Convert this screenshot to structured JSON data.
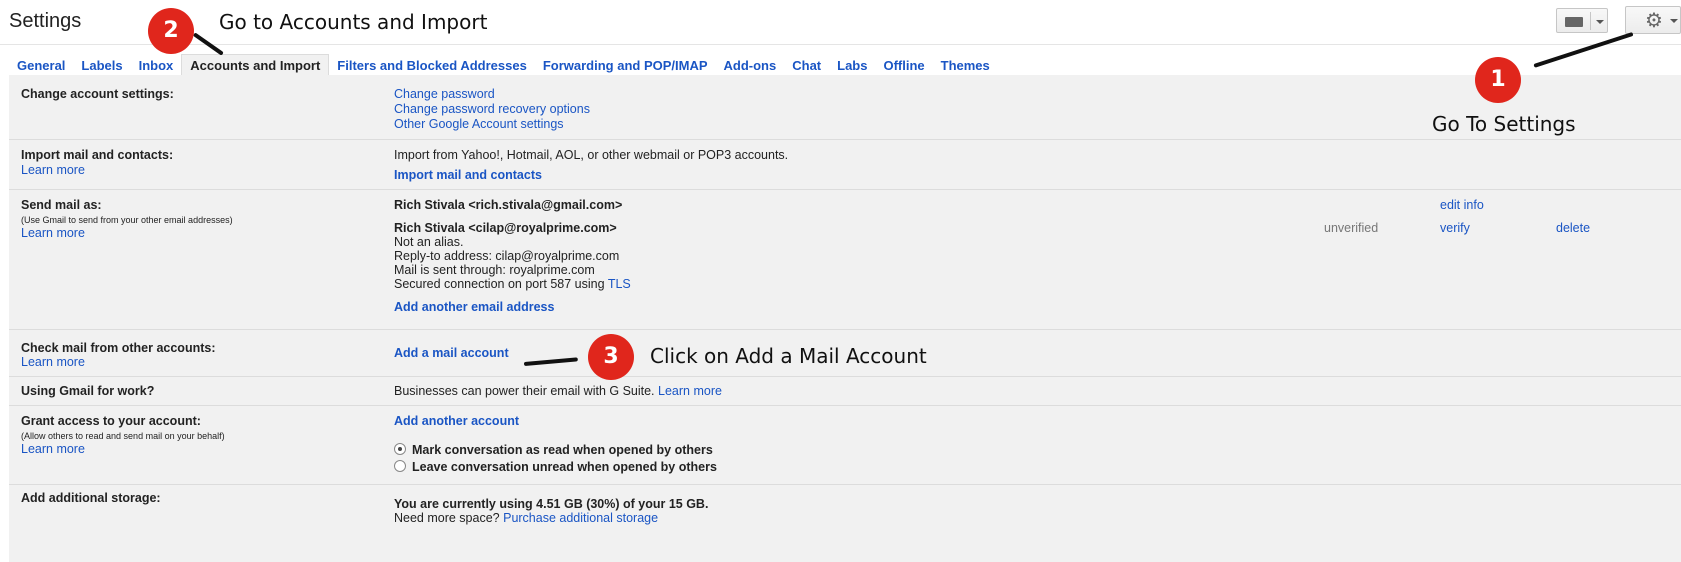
{
  "header": {
    "title": "Settings",
    "keyboard_icon": "keyboard-icon",
    "settings_icon": "gear-icon"
  },
  "tabs": [
    {
      "label": "General"
    },
    {
      "label": "Labels"
    },
    {
      "label": "Inbox"
    },
    {
      "label": "Accounts and Import",
      "active": true
    },
    {
      "label": "Filters and Blocked Addresses"
    },
    {
      "label": "Forwarding and POP/IMAP"
    },
    {
      "label": "Add-ons"
    },
    {
      "label": "Chat"
    },
    {
      "label": "Labs"
    },
    {
      "label": "Offline"
    },
    {
      "label": "Themes"
    }
  ],
  "sections": {
    "change_account": {
      "label": "Change account settings:",
      "links": [
        "Change password",
        "Change password recovery options",
        "Other Google Account settings"
      ]
    },
    "import": {
      "label": "Import mail and contacts:",
      "learn_more": "Learn more",
      "text": "Import from Yahoo!, Hotmail, AOL, or other webmail or POP3 accounts.",
      "action": "Import mail and contacts"
    },
    "send_as": {
      "label": "Send mail as:",
      "note": "(Use Gmail to send from your other email addresses)",
      "learn_more": "Learn more",
      "account1": "Rich Stivala <rich.stivala@gmail.com>",
      "edit_info": "edit info",
      "account2": "Rich Stivala <cilap@royalprime.com>",
      "status": "unverified",
      "verify": "verify",
      "delete": "delete",
      "alias": "Not an alias.",
      "reply_to": "Reply-to address: cilap@royalprime.com",
      "sent_through": "Mail is sent through: royalprime.com",
      "secured": "Secured connection on port 587 using",
      "tls": "TLS",
      "add_address": "Add another email address"
    },
    "check_mail": {
      "label": "Check mail from other accounts:",
      "learn_more": "Learn more",
      "action": "Add a mail account"
    },
    "work": {
      "label": "Using Gmail for work?",
      "text": "Businesses can power their email with G Suite.",
      "learn_more": "Learn more"
    },
    "grant": {
      "label": "Grant access to your account:",
      "note": "(Allow others to read and send mail on your behalf)",
      "learn_more": "Learn more",
      "action": "Add another account",
      "opt1": "Mark conversation as read when opened by others",
      "opt2": "Leave conversation unread when opened by others",
      "selected": "opt1"
    },
    "storage": {
      "label": "Add additional storage:",
      "usage": "You are currently using 4.51 GB (30%) of your 15 GB.",
      "need_more": "Need more space?",
      "purchase": "Purchase additional storage"
    }
  },
  "annotations": {
    "step1": {
      "num": "1",
      "text": "Go To Settings"
    },
    "step2": {
      "num": "2",
      "text": "Go to Accounts and Import"
    },
    "step3": {
      "num": "3",
      "text": "Click on Add a Mail Account"
    },
    "badge_color": "#e0261c"
  }
}
